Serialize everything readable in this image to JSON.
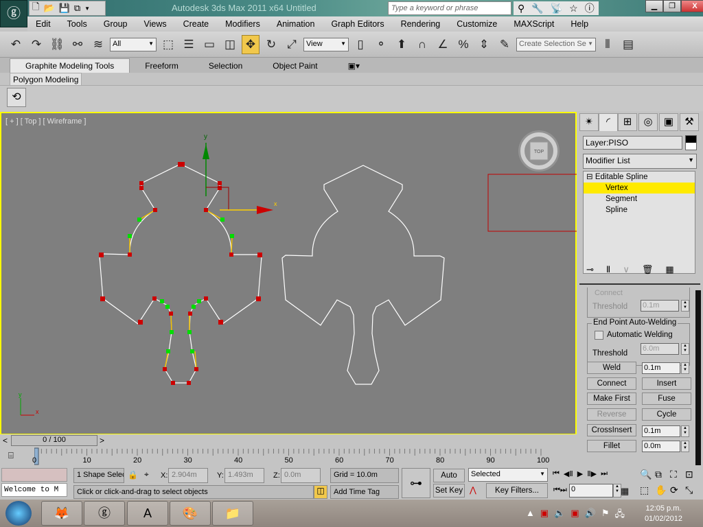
{
  "title": "Autodesk 3ds Max  2011 x64     Untitled",
  "search": {
    "placeholder": "Type a keyword or phrase"
  },
  "menu": [
    "Edit",
    "Tools",
    "Group",
    "Views",
    "Create",
    "Modifiers",
    "Animation",
    "Graph Editors",
    "Rendering",
    "Customize",
    "MAXScript",
    "Help"
  ],
  "toolbar": {
    "selection_filter": "All",
    "ref_coord": "View",
    "named_selection": "Create Selection Se"
  },
  "ribbon": {
    "tabs": [
      "Graphite Modeling Tools",
      "Freeform",
      "Selection",
      "Object Paint"
    ],
    "panel": "Polygon Modeling"
  },
  "viewport": {
    "label": "[ + ] [ Top ] [ Wireframe ]",
    "axis_x": "x",
    "axis_y": "y",
    "viewcube": "TOP"
  },
  "colors": {
    "viewport_border": "#ffff00",
    "vertex": "#cc0000",
    "handle": "#00dd00",
    "selection": "#ffea00"
  },
  "command_panel": {
    "layer": "Layer:PISO",
    "modifier_list": "Modifier List",
    "stack": [
      {
        "label": "Editable Spline"
      },
      {
        "label": "Vertex",
        "selected": true
      },
      {
        "label": "Segment"
      },
      {
        "label": "Spline"
      }
    ],
    "connect_label": "Connect",
    "threshold1_label": "Threshold",
    "threshold1": "0.1m",
    "autoweld_group": "End Point Auto-Welding",
    "autoweld_label": "Automatic Welding",
    "threshold2_label": "Threshold",
    "threshold2": "6.0m",
    "weld": "Weld",
    "weld_value": "0.1m",
    "connect": "Connect",
    "insert": "Insert",
    "make_first": "Make First",
    "fuse": "Fuse",
    "reverse": "Reverse",
    "cycle": "Cycle",
    "crossinsert": "CrossInsert",
    "crossinsert_value": "0.1m",
    "fillet": "Fillet",
    "fillet_value": "0.0m"
  },
  "timeline": {
    "position": "0 / 100",
    "ticks": [
      "0",
      "10",
      "20",
      "30",
      "40",
      "50",
      "60",
      "70",
      "80",
      "90",
      "100"
    ]
  },
  "status": {
    "maxscript": "Welcome to M",
    "selection": "1 Shape Selec",
    "x_label": "X:",
    "x": "2.904m",
    "y_label": "Y:",
    "y": "1.493m",
    "z_label": "Z:",
    "z": "0.0m",
    "grid": "Grid = 10.0m",
    "prompt": "Click or click-and-drag to select objects",
    "add_time_tag": "Add Time Tag",
    "auto_key": "Auto Key",
    "set_key": "Set Key",
    "key_mode": "Selected",
    "key_filters": "Key Filters...",
    "frame": "0"
  },
  "taskbar": {
    "time": "12:05 p.m.",
    "date": "01/02/2012"
  }
}
